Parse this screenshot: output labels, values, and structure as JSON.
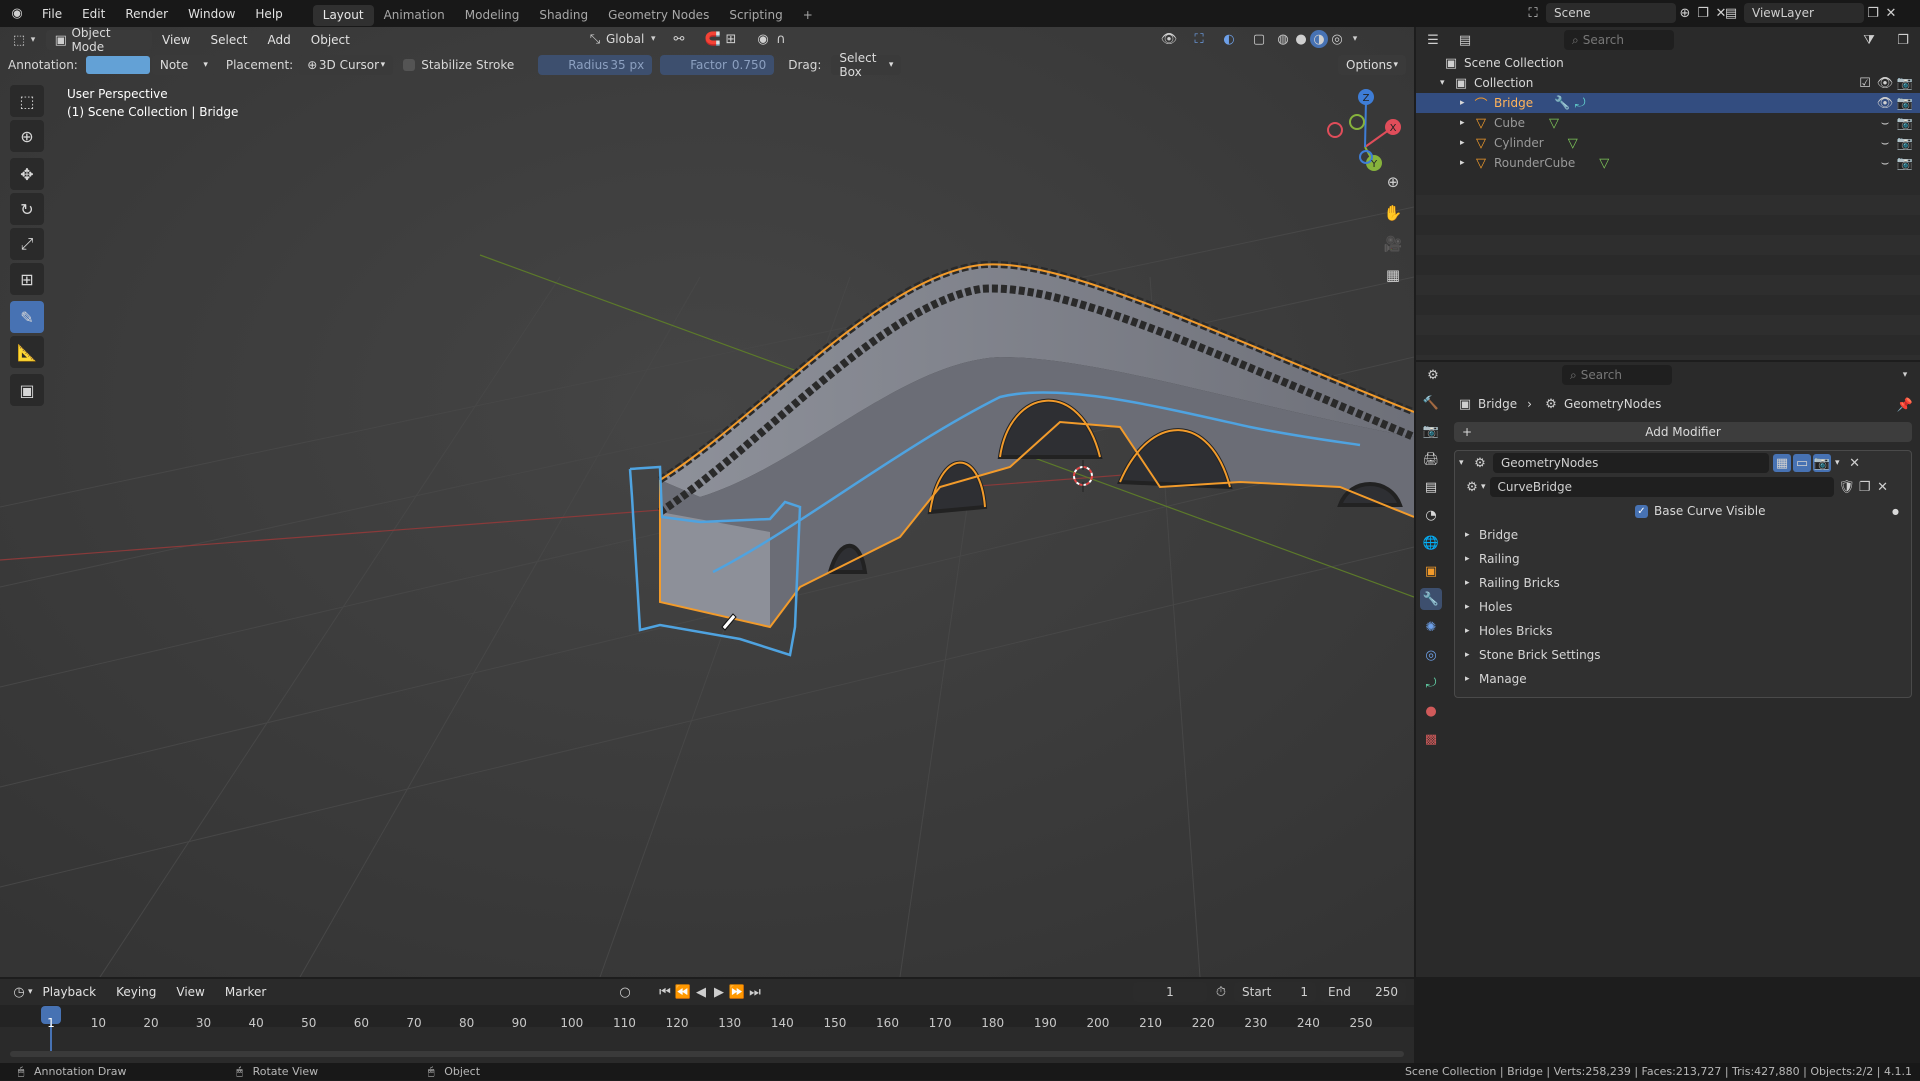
{
  "topbar": {
    "menus": [
      "File",
      "Edit",
      "Render",
      "Window",
      "Help"
    ],
    "workspaces": [
      "Layout",
      "Animation",
      "Modeling",
      "Shading",
      "Geometry Nodes",
      "Scripting"
    ],
    "active_workspace": "Layout",
    "add_tab": "+",
    "scene_name": "Scene",
    "view_layer": "ViewLayer"
  },
  "viewport_header": {
    "mode": "Object Mode",
    "menus": [
      "View",
      "Select",
      "Add",
      "Object"
    ],
    "transform_orientation": "Global"
  },
  "tool_settings": {
    "annotation_label": "Annotation:",
    "annotation_layer": "Note",
    "placement_label": "Placement:",
    "placement_value": "3D Cursor",
    "stabilize_label": "Stabilize Stroke",
    "radius_label": "Radius",
    "radius_value": "35 px",
    "factor_label": "Factor",
    "factor_value": "0.750",
    "drag_label": "Drag:",
    "drag_value": "Select Box",
    "options_label": "Options"
  },
  "viewport": {
    "view_name": "User Perspective",
    "object_path": "(1) Scene Collection | Bridge",
    "axis_labels": {
      "x": "X",
      "y": "Y",
      "z": "Z"
    }
  },
  "outliner": {
    "search_placeholder": "Search",
    "root": "Scene Collection",
    "collection": "Collection",
    "objects": [
      {
        "name": "Bridge",
        "selected": true
      },
      {
        "name": "Cube",
        "selected": false
      },
      {
        "name": "Cylinder",
        "selected": false
      },
      {
        "name": "RounderCube",
        "selected": false
      }
    ]
  },
  "properties": {
    "search_placeholder": "Search",
    "breadcrumb_object": "Bridge",
    "breadcrumb_modifier": "GeometryNodes",
    "add_modifier": "Add Modifier",
    "modifier_name": "GeometryNodes",
    "node_group": "CurveBridge",
    "base_curve_label": "Base Curve Visible",
    "panels": [
      "Bridge",
      "Railing",
      "Railing Bricks",
      "Holes",
      "Holes Bricks",
      "Stone Brick Settings",
      "Manage"
    ]
  },
  "timeline": {
    "menus": [
      "Playback",
      "Keying",
      "View",
      "Marker"
    ],
    "current_frame": "1",
    "start_label": "Start",
    "start_value": "1",
    "end_label": "End",
    "end_value": "250",
    "ticks": [
      "1",
      "10",
      "20",
      "30",
      "40",
      "50",
      "60",
      "70",
      "80",
      "90",
      "100",
      "110",
      "120",
      "130",
      "140",
      "150",
      "160",
      "170",
      "180",
      "190",
      "200",
      "210",
      "220",
      "230",
      "240",
      "250"
    ]
  },
  "statusbar": {
    "left_hint": "Annotation Draw",
    "middle_hint": "Rotate View",
    "right_hint": "Object",
    "stats": "Scene Collection | Bridge | Verts:258,239 | Faces:213,727 | Tris:427,880 | Objects:2/2 | 4.1.1"
  },
  "colors": {
    "accent": "#4772b3",
    "selection_orange": "#f29b2b",
    "annotation_blue": "#4fa3e0",
    "axis_red": "#b8443f",
    "axis_green": "#6a9a2c"
  }
}
